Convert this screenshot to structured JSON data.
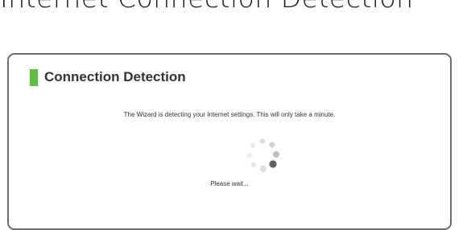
{
  "page": {
    "heading": "Internet Connection Detection"
  },
  "panel": {
    "title": "Connection Detection",
    "accent_color": "#5cbf3e",
    "message": "The Wizard is detecting your Internet settings. This will only take a minute.",
    "wait_text": "Please wait..."
  },
  "spinner": {
    "icon": "loading-spinner-icon"
  }
}
